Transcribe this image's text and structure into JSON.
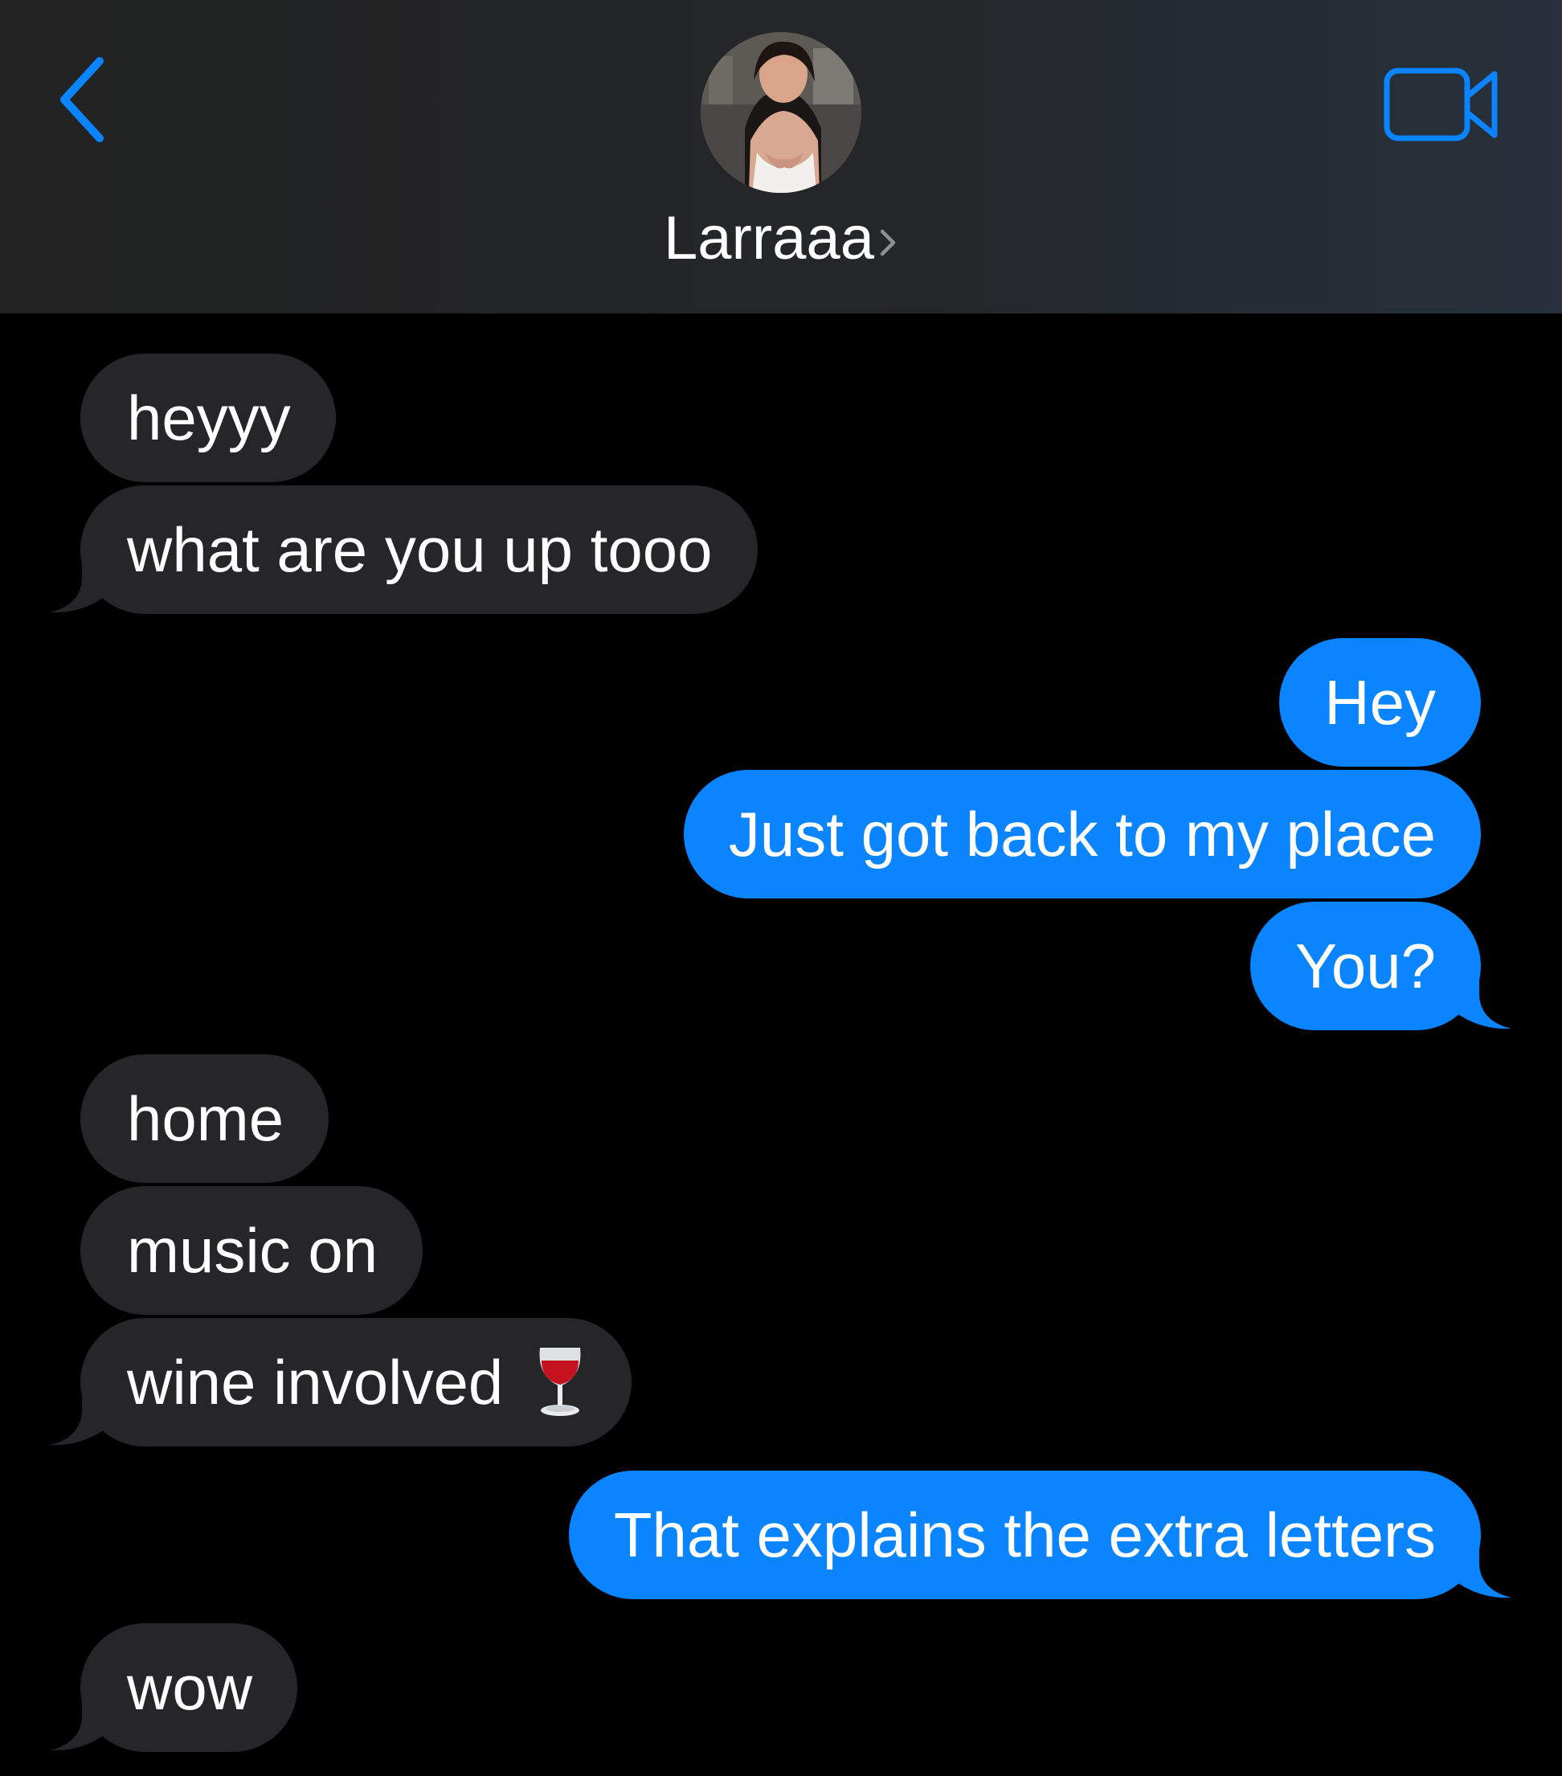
{
  "header": {
    "contact_name": "Larraaa",
    "icons": {
      "back": "chevron-left-icon",
      "video": "video-camera-icon",
      "name_chevron": "chevron-right-icon"
    },
    "accent_color": "#0a84ff"
  },
  "thread": {
    "incoming_bubble_color": "#262629",
    "outgoing_bubble_color": "#0a84ff",
    "messages": [
      {
        "direction": "incoming",
        "text": "heyyy"
      },
      {
        "direction": "incoming",
        "text": "what are you up tooo"
      },
      {
        "direction": "outgoing",
        "text": "Hey"
      },
      {
        "direction": "outgoing",
        "text": "Just got back to my place"
      },
      {
        "direction": "outgoing",
        "text": "You?"
      },
      {
        "direction": "incoming",
        "text": "home"
      },
      {
        "direction": "incoming",
        "text": "music on"
      },
      {
        "direction": "incoming",
        "text": "wine involved",
        "emoji": "wine-glass-icon"
      },
      {
        "direction": "outgoing",
        "text": "That explains the extra letters"
      },
      {
        "direction": "incoming",
        "text": "wow"
      }
    ]
  }
}
